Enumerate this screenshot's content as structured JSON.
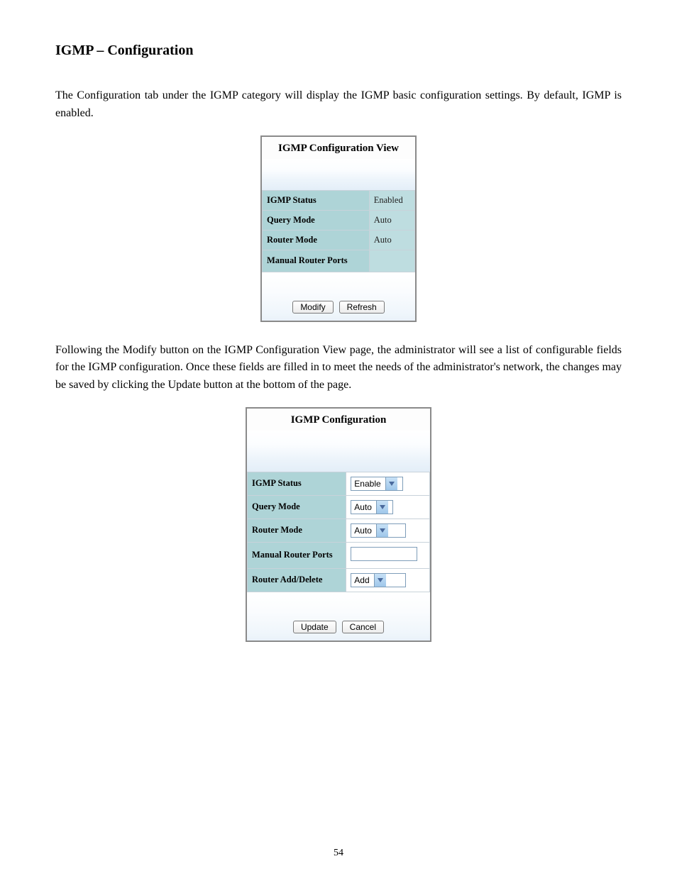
{
  "heading": "IGMP – Configuration",
  "intro_text": "The Configuration tab under the IGMP category will display the IGMP basic configuration settings. By default, IGMP is enabled.",
  "view_panel": {
    "title": "IGMP Configuration View",
    "rows": [
      {
        "label": "IGMP Status",
        "value": "Enabled"
      },
      {
        "label": "Query Mode",
        "value": "Auto"
      },
      {
        "label": "Router Mode",
        "value": "Auto"
      },
      {
        "label": "Manual Router Ports",
        "value": ""
      }
    ],
    "buttons": {
      "modify": "Modify",
      "refresh": "Refresh"
    }
  },
  "mid_text": "Following the Modify button on the IGMP Configuration View page, the administrator will see a list of configurable fields for the IGMP configuration.  Once these fields are filled in to meet the needs of the administrator's network, the changes may be saved by clicking the Update button at the bottom of the page.",
  "config_panel": {
    "title": "IGMP Configuration",
    "rows": {
      "igmp_status": {
        "label": "IGMP Status",
        "selected": "Enable"
      },
      "query_mode": {
        "label": "Query Mode",
        "selected": "Auto"
      },
      "router_mode": {
        "label": "Router Mode",
        "selected": "Auto"
      },
      "manual_ports": {
        "label": "Manual Router Ports",
        "value": ""
      },
      "router_add": {
        "label": "Router Add/Delete",
        "selected": "Add"
      }
    },
    "buttons": {
      "update": "Update",
      "cancel": "Cancel"
    }
  },
  "page_number": "54"
}
